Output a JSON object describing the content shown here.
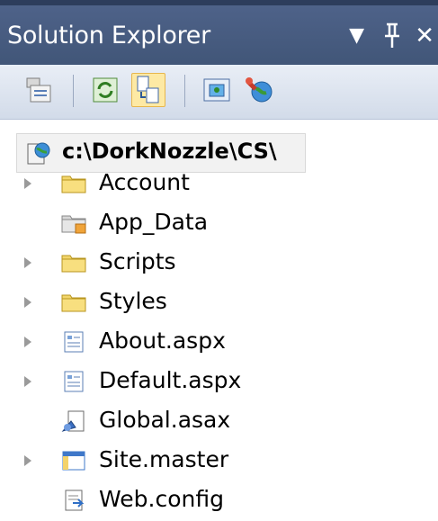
{
  "panel": {
    "title": "Solution Explorer"
  },
  "title_buttons": [
    {
      "name": "dropdown-button",
      "glyph": "▾"
    },
    {
      "name": "pin-button",
      "glyph": "⊥"
    },
    {
      "name": "close-button",
      "glyph": "×"
    }
  ],
  "toolbar": {
    "tools": [
      {
        "name": "properties-button",
        "icon": "properties-icon"
      },
      {
        "name": "refresh-button",
        "icon": "refresh-icon"
      },
      {
        "name": "nest-related-files-button",
        "icon": "nest-files-icon",
        "active": true
      },
      {
        "name": "view-designer-button",
        "icon": "view-designer-icon"
      },
      {
        "name": "asp-net-configuration-button",
        "icon": "web-config-tool-icon"
      }
    ]
  },
  "tree": {
    "root": {
      "label": "c:\\DorkNozzle\\CS\\",
      "icon": "website-project-icon"
    },
    "items": [
      {
        "label": "Account",
        "icon": "folder-icon",
        "expandable": true
      },
      {
        "label": "App_Data",
        "icon": "special-folder-icon",
        "expandable": false
      },
      {
        "label": "Scripts",
        "icon": "folder-icon",
        "expandable": true
      },
      {
        "label": "Styles",
        "icon": "folder-icon",
        "expandable": true
      },
      {
        "label": "About.aspx",
        "icon": "aspx-file-icon",
        "expandable": true
      },
      {
        "label": "Default.aspx",
        "icon": "aspx-file-icon",
        "expandable": true
      },
      {
        "label": "Global.asax",
        "icon": "asax-file-icon",
        "expandable": false
      },
      {
        "label": "Site.master",
        "icon": "master-page-icon",
        "expandable": true
      },
      {
        "label": "Web.config",
        "icon": "config-file-icon",
        "expandable": false
      }
    ]
  }
}
